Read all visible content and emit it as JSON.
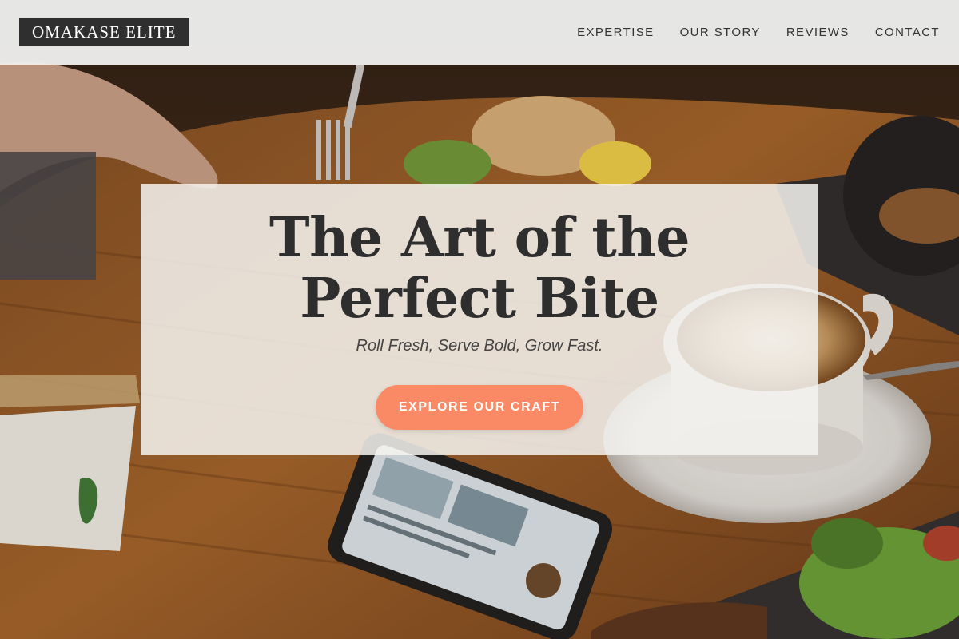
{
  "header": {
    "brand": "OMAKASE ELITE",
    "nav": [
      "EXPERTISE",
      "OUR STORY",
      "REVIEWS",
      "CONTACT"
    ]
  },
  "hero": {
    "title": "The Art of the Perfect Bite",
    "subtitle": "Roll Fresh, Serve Bold, Grow Fast.",
    "cta_label": "EXPLORE OUR CRAFT",
    "background": "cafe table photo with coffee cup, smartphone, salad plate and fork"
  },
  "colors": {
    "accent": "#fa8a66",
    "brand_bg": "#2f2f2f",
    "header_bg": "#eeeeee",
    "text_dark": "#2e2e2e"
  }
}
